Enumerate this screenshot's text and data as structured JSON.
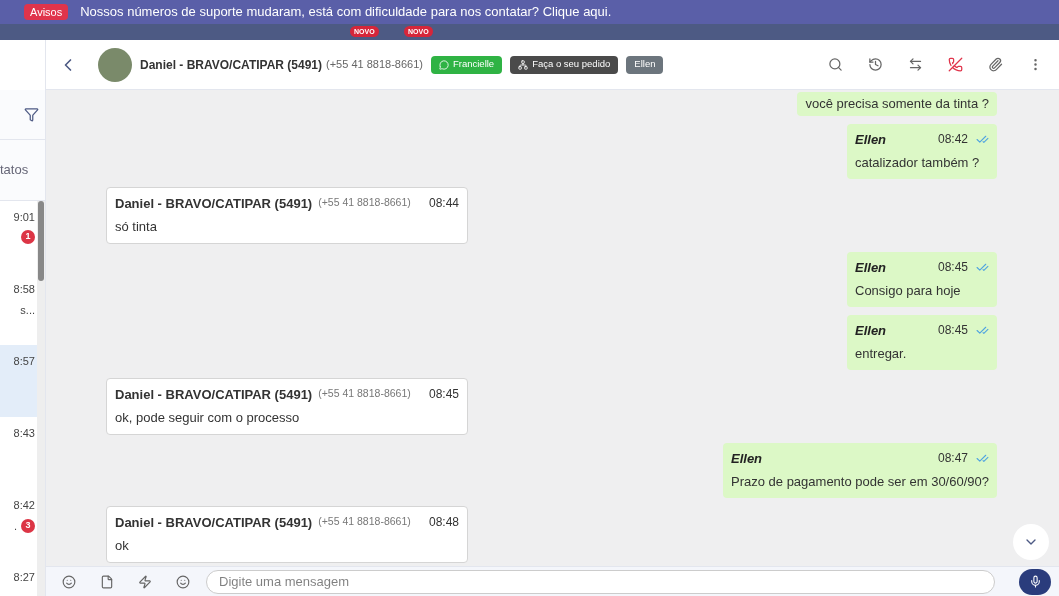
{
  "banner": {
    "badge": "Avisos",
    "text": "Nossos números de suporte mudaram, está com dificuldade para nos contatar? Clique aqui."
  },
  "nav_badges": [
    "NOVO",
    "NOVO"
  ],
  "sidebar": {
    "tab_label": "tatos",
    "items": [
      {
        "time": "9:01",
        "unread": "1",
        "selected": false
      },
      {
        "time": "8:58",
        "preview": "s...",
        "selected": false
      },
      {
        "time": "8:57",
        "selected": true
      },
      {
        "time": "8:43",
        "selected": false
      },
      {
        "time": "8:42",
        "preview": ".",
        "unread": "3",
        "selected": false
      },
      {
        "time": "8:27",
        "selected": false
      }
    ]
  },
  "header": {
    "contact": "Daniel - BRAVO/CATIPAR (5491)",
    "phone": "(+55 41 8818-8661)",
    "tags": [
      {
        "kind": "whatsapp",
        "label": "Francielle"
      },
      {
        "kind": "order",
        "label": "Faça o seu pedido"
      },
      {
        "kind": "user",
        "label": "Ellen"
      }
    ]
  },
  "messages": [
    {
      "kind": "out",
      "text": "você precisa somente da tinta ?"
    },
    {
      "kind": "out",
      "author": "Ellen",
      "time": "08:42",
      "text": "catalizador também ?"
    },
    {
      "kind": "in",
      "author": "Daniel - BRAVO/CATIPAR (5491)",
      "phone": "(+55 41 8818-8661)",
      "time": "08:44",
      "text": "só tinta"
    },
    {
      "kind": "out",
      "author": "Ellen",
      "time": "08:45",
      "text": "Consigo para hoje"
    },
    {
      "kind": "out",
      "author": "Ellen",
      "time": "08:45",
      "text": "entregar."
    },
    {
      "kind": "in",
      "author": "Daniel - BRAVO/CATIPAR (5491)",
      "phone": "(+55 41 8818-8661)",
      "time": "08:45",
      "text": "ok, pode seguir com o processo"
    },
    {
      "kind": "out",
      "author": "Ellen",
      "time": "08:47",
      "text": "Prazo de pagamento pode ser em 30/60/90?"
    },
    {
      "kind": "in",
      "author": "Daniel - BRAVO/CATIPAR (5491)",
      "phone": "(+55 41 8818-8661)",
      "time": "08:48",
      "text": "ok"
    }
  ],
  "composer": {
    "placeholder": "Digite uma mensagem"
  }
}
